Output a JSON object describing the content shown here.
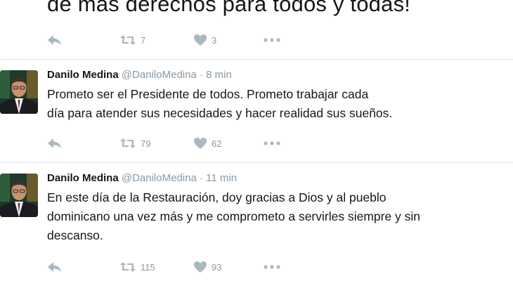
{
  "top_tweet": {
    "text": "de más derechos para todos y todas!",
    "retweets": "7",
    "likes": "3"
  },
  "tweets": [
    {
      "name": "Danilo Medina",
      "handle": "@DaniloMedina",
      "separator": "·",
      "time": "8 min",
      "lines": [
        "Prometo ser el Presidente de todos. Prometo trabajar cada",
        "día para atender sus necesidades y hacer realidad sus  sueños."
      ],
      "retweets": "79",
      "likes": "62"
    },
    {
      "name": "Danilo Medina",
      "handle": "@DaniloMedina",
      "separator": "·",
      "time": "11 min",
      "lines": [
        "En este día de la Restauración, doy gracias a Dios y al pueblo",
        "dominicano una vez más y me comprometo a servirles siempre y sin",
        "descanso."
      ],
      "retweets": "115",
      "likes": "93"
    }
  ],
  "icons": {
    "reply": "reply-icon",
    "retweet": "retweet-icon",
    "like": "heart-icon",
    "more": "more-icon"
  },
  "colors": {
    "text": "#14171a",
    "muted": "#8899a6",
    "icon": "#aab8c2",
    "divider": "#e1e8ed"
  }
}
